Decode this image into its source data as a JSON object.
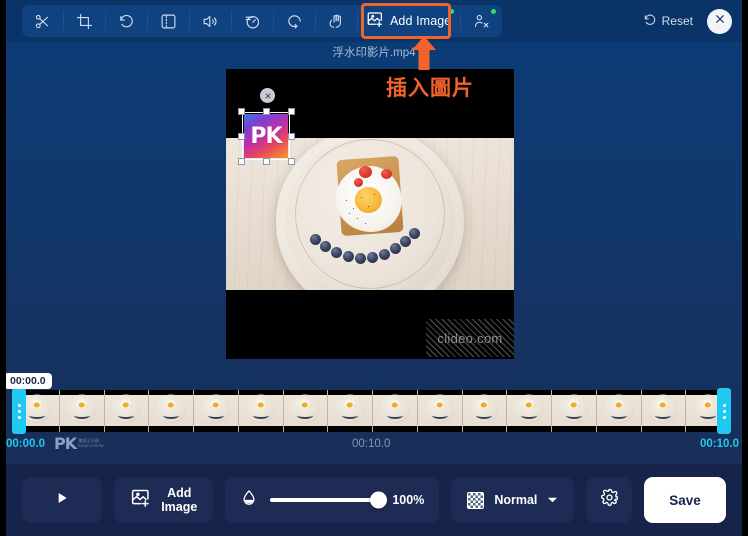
{
  "app": {
    "accent_orange": "#f0632a",
    "accent_cyan": "#1ec8f0",
    "bg_top": "#0b3d79",
    "bg_bottom": "#1b2b52"
  },
  "header": {
    "tools": [
      {
        "name": "cut-icon",
        "label": "Cut"
      },
      {
        "name": "crop-icon",
        "label": "Crop"
      },
      {
        "name": "rotate-icon",
        "label": "Rotate"
      },
      {
        "name": "resize-icon",
        "label": "Resize"
      },
      {
        "name": "volume-icon",
        "label": "Volume"
      },
      {
        "name": "speed-icon",
        "label": "Speed"
      },
      {
        "name": "loop-icon",
        "label": "Loop"
      },
      {
        "name": "stabilize-icon",
        "label": "Stabilize"
      }
    ],
    "add_image": {
      "label": "Add Image",
      "icon": "add-image-icon",
      "badge": "new"
    },
    "remove_watermark": {
      "icon": "remove-person-icon",
      "badge": "new"
    },
    "reset_label": "Reset",
    "reset_icon": "reset-icon",
    "close_icon": "close-icon"
  },
  "file": {
    "name": "浮水印影片.mp4"
  },
  "annotation": {
    "text": "插入圖片",
    "arrow": "up-arrow-icon",
    "color": "#f0632a"
  },
  "preview": {
    "watermark_text": "clideo.com",
    "overlay": {
      "logo_text": "PK",
      "delete_icon": "close-icon",
      "handle_count": 8
    }
  },
  "timeline": {
    "playhead_tooltip": "00:00.0",
    "start_label": "00:00.0",
    "end_label": "00:10.0",
    "duration_label": "00:10.0",
    "thumbnail_count": 16,
    "watermark_main": "PK",
    "watermark_sub_1": "電腦王阿達",
    "watermark_sub_2": "kocpc.com.tw",
    "trim_left_icon": "trim-handle-icon",
    "trim_right_icon": "trim-handle-icon"
  },
  "controls": {
    "play_icon": "play-icon",
    "add_image_line1": "Add",
    "add_image_line2": "Image",
    "add_image_icon": "add-image-icon",
    "opacity_icon": "opacity-droplet-icon",
    "opacity_value": "100%",
    "blend_icon": "checkerboard-icon",
    "blend_value": "Normal",
    "blend_caret": "chevron-down-icon",
    "settings_icon": "gear-icon",
    "save_label": "Save"
  }
}
